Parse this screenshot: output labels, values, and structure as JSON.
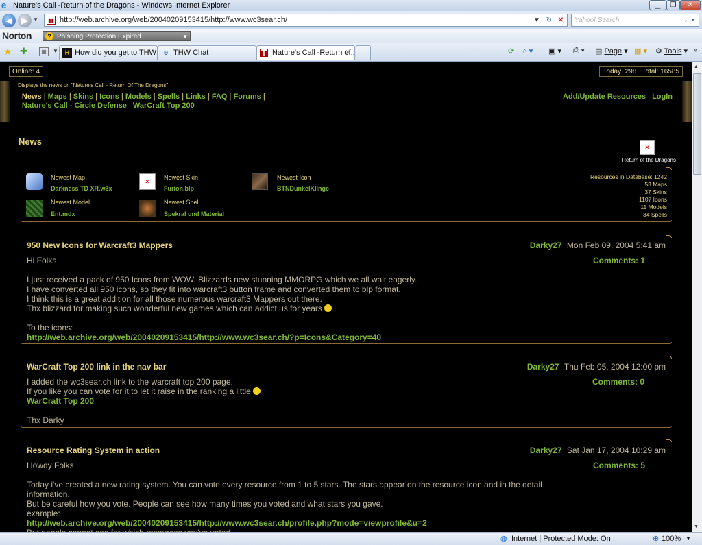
{
  "window": {
    "title": "Nature's Call -Return of the Dragons - Windows Internet Explorer",
    "controls": [
      "minimize",
      "maximize",
      "close"
    ]
  },
  "browser": {
    "url": "http://web.archive.org/web/20040209153415/http://www.wc3sear.ch/",
    "search_placeholder": "Yahoo! Search",
    "norton_label": "Norton",
    "phishing_label": "Phishing Protection Expired",
    "tabs": [
      {
        "label": "How did you get to THW? ...",
        "icon": "thw-favicon"
      },
      {
        "label": "THW Chat",
        "icon": "ie-favicon"
      },
      {
        "label": "Nature's Call -Return of...",
        "icon": "wc3sear-favicon",
        "active": true
      }
    ],
    "toolbar": {
      "page_label": "Page",
      "tools_label": "Tools"
    },
    "status": {
      "zone": "Internet | Protected Mode: On",
      "zoom": "100%"
    }
  },
  "site": {
    "online": "Online: 4",
    "stats": "Today: 298   Total: 16585",
    "tagline": "Displays the news on \"Nature's Call - Return Of The Dragons\"",
    "nav_row1": [
      "News",
      "Maps",
      "Skins",
      "Icons",
      "Models",
      "Spells",
      "Links",
      "FAQ",
      "Forums"
    ],
    "nav_row2": [
      "Nature's Call - Circle Defense",
      "WarCraft Top 200"
    ],
    "nav_right": [
      "Add/Update Resources",
      "LogIn"
    ],
    "section_title": "News",
    "logo_caption": "Return of the Dragons",
    "newest": [
      {
        "label": "Newest Map",
        "value": "Darkness TD XR.w3x",
        "icon": "map-scroll-icon"
      },
      {
        "label": "Newest Skin",
        "value": "Furion.blp",
        "icon": "broken-image-icon"
      },
      {
        "label": "Newest Icon",
        "value": "BTNDunkelKlinge",
        "icon": "sword-icon"
      },
      {
        "label": "Newest Model",
        "value": "Ent.mdx",
        "icon": "forest-model-icon"
      },
      {
        "label": "Newest Spell",
        "value": "Spekral und Material",
        "icon": "spell-icon"
      }
    ],
    "resources": [
      "Resources in Database: 1242",
      "53 Maps",
      "37 Skins",
      "1107 Icons",
      "11 Models",
      "34 Spells"
    ]
  },
  "posts": [
    {
      "title": "950 New Icons for Warcraft3 Mappers",
      "author": "Darky27",
      "date": "Mon Feb 09, 2004 5:41 am",
      "comments": "Comments: 1",
      "lines": [
        {
          "t": "Hi Folks"
        },
        {
          "t": ""
        },
        {
          "t": "I just received a pack of 950 Icons from WOW. Blizzards new stunning MMORPG which we all wait eagerly."
        },
        {
          "t": "I have converted all 950 icons, so they fit into warcraft3 button frame and converted them to blp format."
        },
        {
          "t": "I think this is a great addition for all those numerous warcraft3 Mappers out there."
        },
        {
          "t": "Thx blizzard for making such wonderful new games which can addict us for years",
          "smiley": true
        },
        {
          "t": ""
        },
        {
          "t": "To the icons:"
        },
        {
          "t": "http://web.archive.org/web/20040209153415/http://www.wc3sear.ch/?p=Icons&Category=40",
          "link": true
        }
      ]
    },
    {
      "title": "WarCraft Top 200 link in the nav bar",
      "author": "Darky27",
      "date": "Thu Feb 05, 2004 12:00 pm",
      "comments": "Comments: 0",
      "lines": [
        {
          "t": "I added the wc3sear.ch link to the warcraft top 200 page."
        },
        {
          "t": "If you like you can vote for it to let it raise in the ranking a little",
          "smiley": true
        },
        {
          "t": "WarCraft Top 200",
          "link": true
        },
        {
          "t": ""
        },
        {
          "t": "Thx Darky"
        }
      ]
    },
    {
      "title": "Resource Rating System in action",
      "author": "Darky27",
      "date": "Sat Jan 17, 2004 10:29 am",
      "comments": "Comments: 5",
      "lines": [
        {
          "t": "Howdy Folks"
        },
        {
          "t": ""
        },
        {
          "t": "Today i've created a new rating system. You can vote every resource from 1 to 5 stars. The stars appear on the resource icon and in the detail"
        },
        {
          "t": "information."
        },
        {
          "t": "But be careful how you vote. People can see how many times you voted and what stars you gave."
        },
        {
          "t": "example:"
        },
        {
          "t": "http://web.archive.org/web/20040209153415/http://www.wc3sear.ch/profile.php?mode=viewprofile&u=2",
          "link": true
        },
        {
          "t": "But people cannot see for which resources you've voted."
        }
      ]
    }
  ]
}
